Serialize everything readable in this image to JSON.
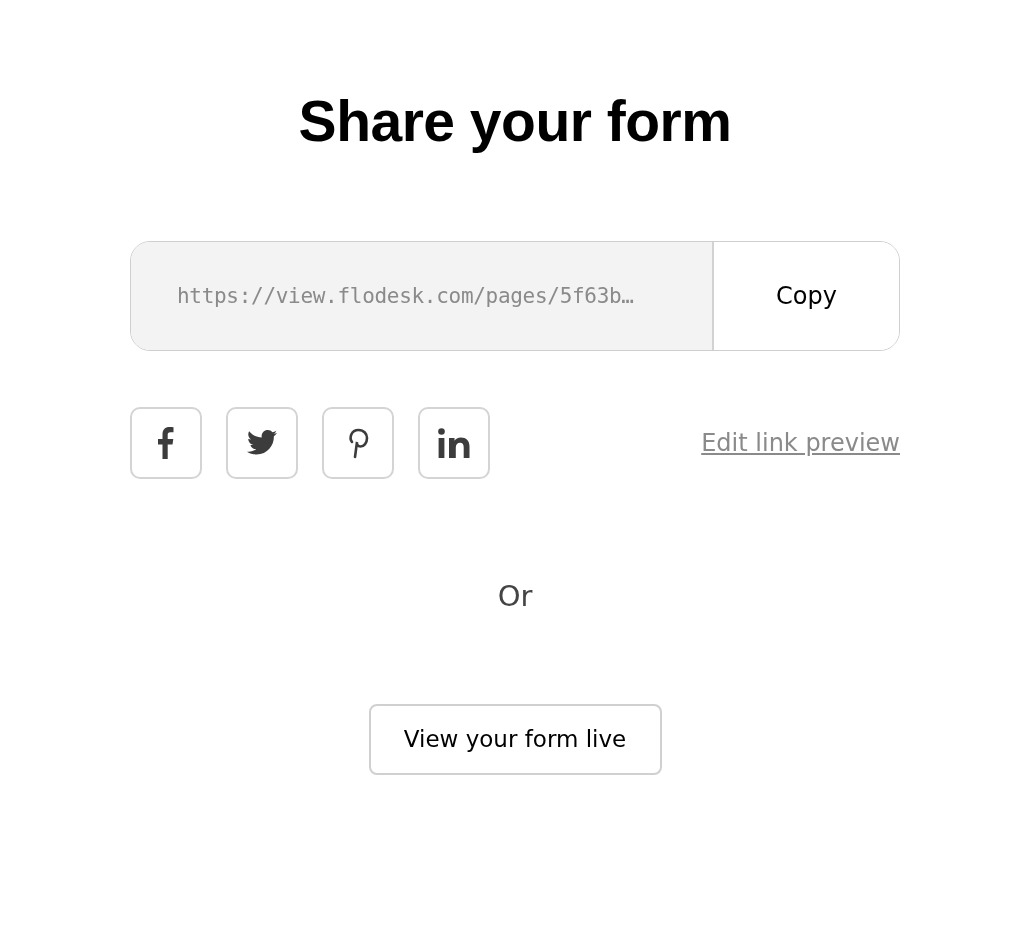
{
  "title": "Share your form",
  "link": {
    "url": "https://view.flodesk.com/pages/5f63b…",
    "copy_button": "Copy"
  },
  "social_buttons": [
    {
      "kind": "facebook"
    },
    {
      "kind": "twitter"
    },
    {
      "kind": "pinterest"
    },
    {
      "kind": "linkedin"
    }
  ],
  "edit_link": "Edit link preview",
  "separator": "Or",
  "view_button": "View your form live"
}
